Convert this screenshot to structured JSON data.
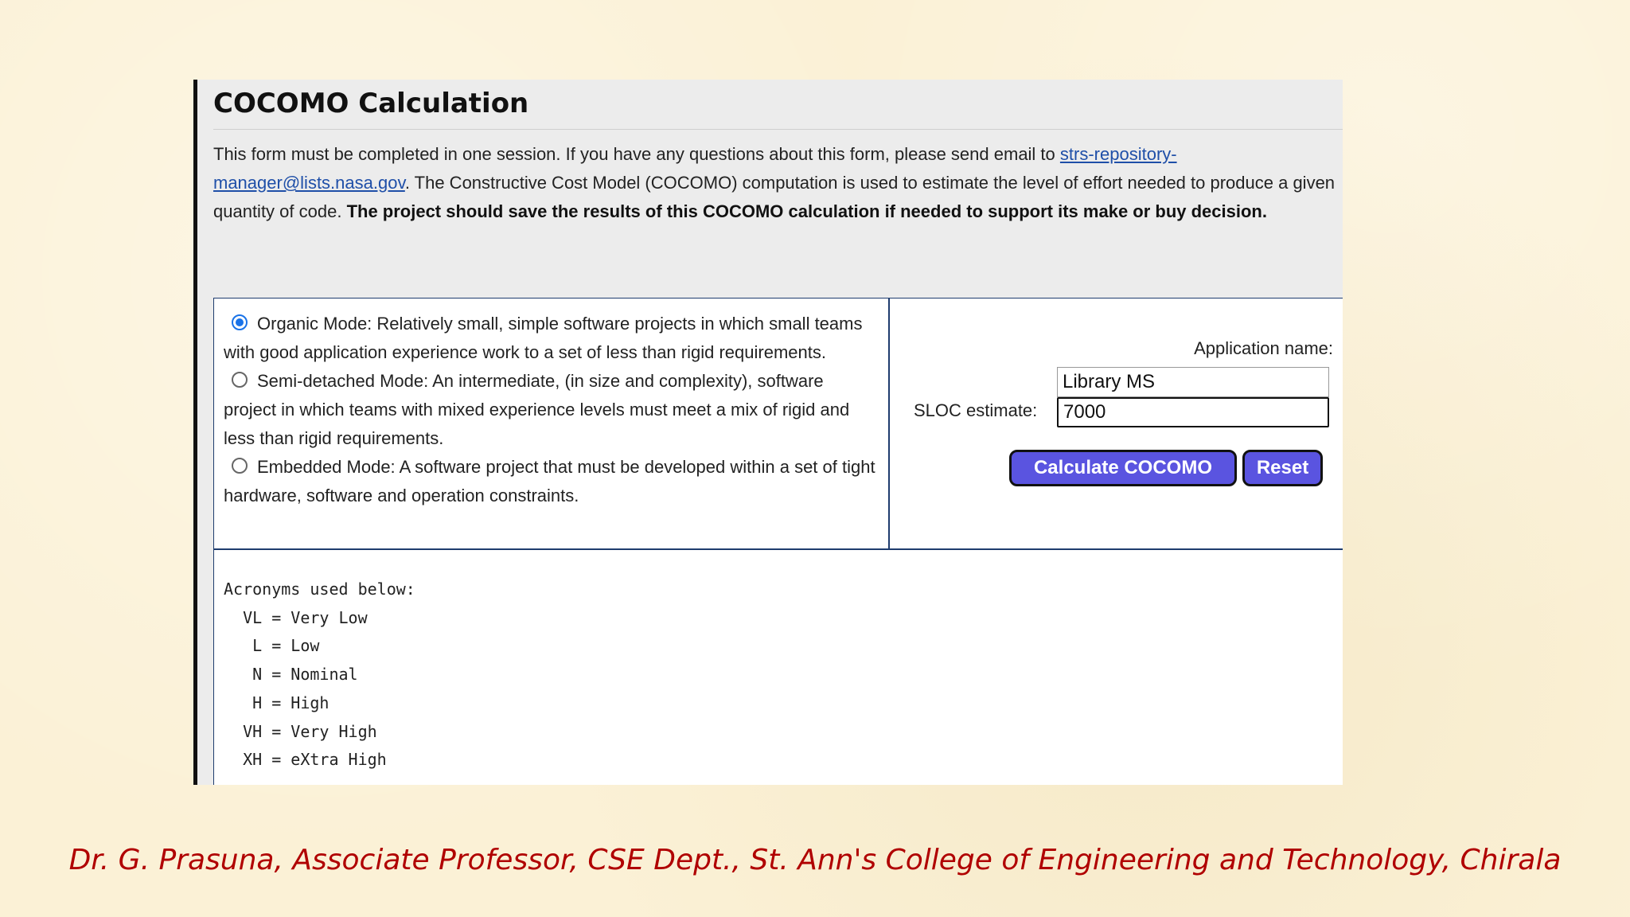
{
  "form": {
    "title": "COCOMO Calculation",
    "intro": {
      "p1": "This form must be completed in one session. If you have any questions about this form, please send email to ",
      "email": "strs-repository-manager@lists.nasa.gov",
      "p2": ". The Constructive Cost Model (COCOMO) computation is used to estimate the level of effort needed to produce a given quantity of code. ",
      "bold": "The project should save the results of this COCOMO calculation if needed to support its make or buy decision."
    },
    "modes": [
      {
        "label": "Organic Mode: Relatively small, simple software projects in which small teams with good application experience work to a set of less than rigid requirements.",
        "selected": true
      },
      {
        "label": "Semi-detached Mode: An intermediate, (in size and complexity), software project in which teams with mixed experience levels must meet a mix of rigid and less than rigid requirements.",
        "selected": false
      },
      {
        "label": "Embedded Mode: A software project that must be developed within a set of tight hardware, software and operation constraints.",
        "selected": false
      }
    ],
    "application_name_label": "Application name:",
    "application_name_value": "Library MS",
    "sloc_label": "SLOC estimate:",
    "sloc_value": "7000",
    "calculate_label": "Calculate COCOMO",
    "reset_label": "Reset",
    "acronyms": [
      "Acronyms used below:",
      "  VL = Very Low",
      "   L = Low",
      "   N = Nominal",
      "   H = High",
      "  VH = Very High",
      "  XH = eXtra High"
    ]
  },
  "footer": "Dr. G. Prasuna, Associate Professor, CSE Dept., St. Ann's College of Engineering and Technology, Chirala",
  "colors": {
    "accent": "#1a73e8",
    "button": "#5a54e0",
    "footer": "#b00000",
    "link": "#1f4fa8"
  }
}
